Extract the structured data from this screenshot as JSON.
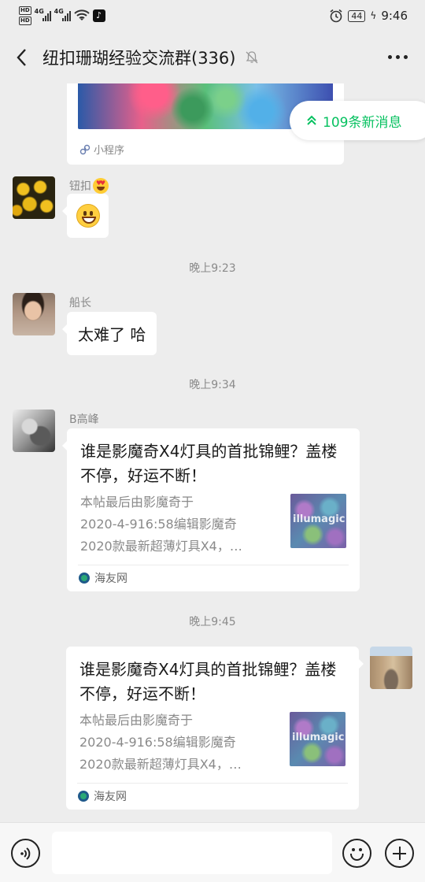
{
  "status_bar": {
    "hd1": "HD",
    "hd2": "HD",
    "net1": "4G",
    "net2": "4G",
    "battery": "44",
    "time": "9:46"
  },
  "header": {
    "title": "纽扣珊瑚经验交流群(336)"
  },
  "new_messages": {
    "label": "109条新消息"
  },
  "messages": {
    "mini_program": {
      "label": "小程序"
    },
    "m1": {
      "sender": "钮扣"
    },
    "time1": "晚上9:23",
    "m2": {
      "sender": "船长",
      "text": "太难了 哈"
    },
    "time2": "晚上9:34",
    "m3": {
      "sender": "B高峰",
      "title": "谁是影魔奇X4灯具的首批锦鲤？盖楼不停，好运不断！",
      "desc_lines": [
        "本帖最后由影魔奇于",
        "2020-4-916:58编辑影魔奇",
        "2020款最新超薄灯具X4，…"
      ],
      "thumb_watermark": "illumagic",
      "source": "海友网"
    },
    "time3": "晚上9:45",
    "m4": {
      "title": "谁是影魔奇X4灯具的首批锦鲤？盖楼不停，好运不断！",
      "desc_lines": [
        "本帖最后由影魔奇于",
        "2020-4-916:58编辑影魔奇",
        "2020款最新超薄灯具X4，…"
      ],
      "thumb_watermark": "illumagic",
      "source": "海友网"
    }
  },
  "input_bar": {
    "value": ""
  }
}
